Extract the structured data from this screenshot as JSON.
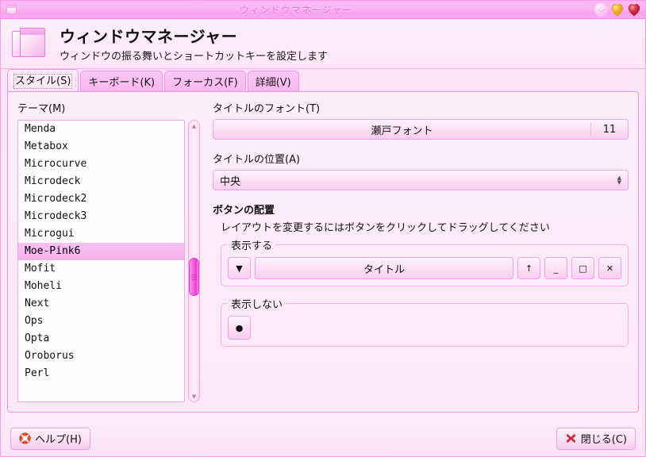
{
  "window": {
    "title": "ウィンドウマネージャー",
    "icon": "window-stack-icon",
    "buttons": [
      {
        "name": "shade-button",
        "glyph": "⬆"
      },
      {
        "name": "maximize-button",
        "glyph": "heart"
      },
      {
        "name": "close-button",
        "glyph": "heart"
      }
    ]
  },
  "header": {
    "icon": "window-stack-icon",
    "title": "ウィンドウマネージャー",
    "subtitle": "ウィンドウの振る舞いとショートカットキーを設定します"
  },
  "tabs": [
    {
      "label": "スタイル(S)",
      "name": "tab-style",
      "active": true
    },
    {
      "label": "キーボード(K)",
      "name": "tab-keyboard",
      "active": false
    },
    {
      "label": "フォーカス(F)",
      "name": "tab-focus",
      "active": false
    },
    {
      "label": "詳細(V)",
      "name": "tab-advanced",
      "active": false
    }
  ],
  "theme": {
    "label": "テーマ(M)",
    "items": [
      "Menda",
      "Metabox",
      "Microcurve",
      "Microdeck",
      "Microdeck2",
      "Microdeck3",
      "Microgui",
      "Moe-Pink6",
      "Mofit",
      "Moheli",
      "Next",
      "Ops",
      "Opta",
      "Oroborus",
      "Perl"
    ],
    "selected": "Moe-Pink6",
    "scrollbar": {
      "up_arrow": "▲",
      "down_arrow": "▼"
    }
  },
  "title_font": {
    "label": "タイトルのフォント(T)",
    "font_name": "瀬戸フォント",
    "font_size": "11"
  },
  "title_align": {
    "label": "タイトルの位置(A)",
    "value": "中央"
  },
  "button_layout": {
    "group_title": "ボタンの配置",
    "hint": "レイアウトを変更するにはボタンをクリックしてドラッグしてください",
    "shown": {
      "legend": "表示する",
      "buttons": [
        {
          "name": "menu-button",
          "glyph": "▼"
        },
        {
          "name": "title-placeholder",
          "glyph": "タイトル"
        },
        {
          "name": "shade-button",
          "glyph": "↑"
        },
        {
          "name": "minimize-button",
          "glyph": "_"
        },
        {
          "name": "maximize-button",
          "glyph": "□"
        },
        {
          "name": "close-button",
          "glyph": "✕"
        }
      ]
    },
    "hidden": {
      "legend": "表示しない",
      "buttons": [
        {
          "name": "stick-button",
          "glyph": "●"
        }
      ]
    }
  },
  "footer": {
    "help_label": "ヘルプ(H)",
    "help_icon": "lifebuoy-icon",
    "close_label": "閉じる(C)",
    "close_icon": "red-x-icon"
  },
  "colors": {
    "titlebar_pink": "#fbb5f5",
    "accent_pink": "#f0a0e6",
    "selection_pink": "#f8c2f2",
    "scroll_thumb": "#f45fe1",
    "page_bg": "#fdeefa"
  }
}
